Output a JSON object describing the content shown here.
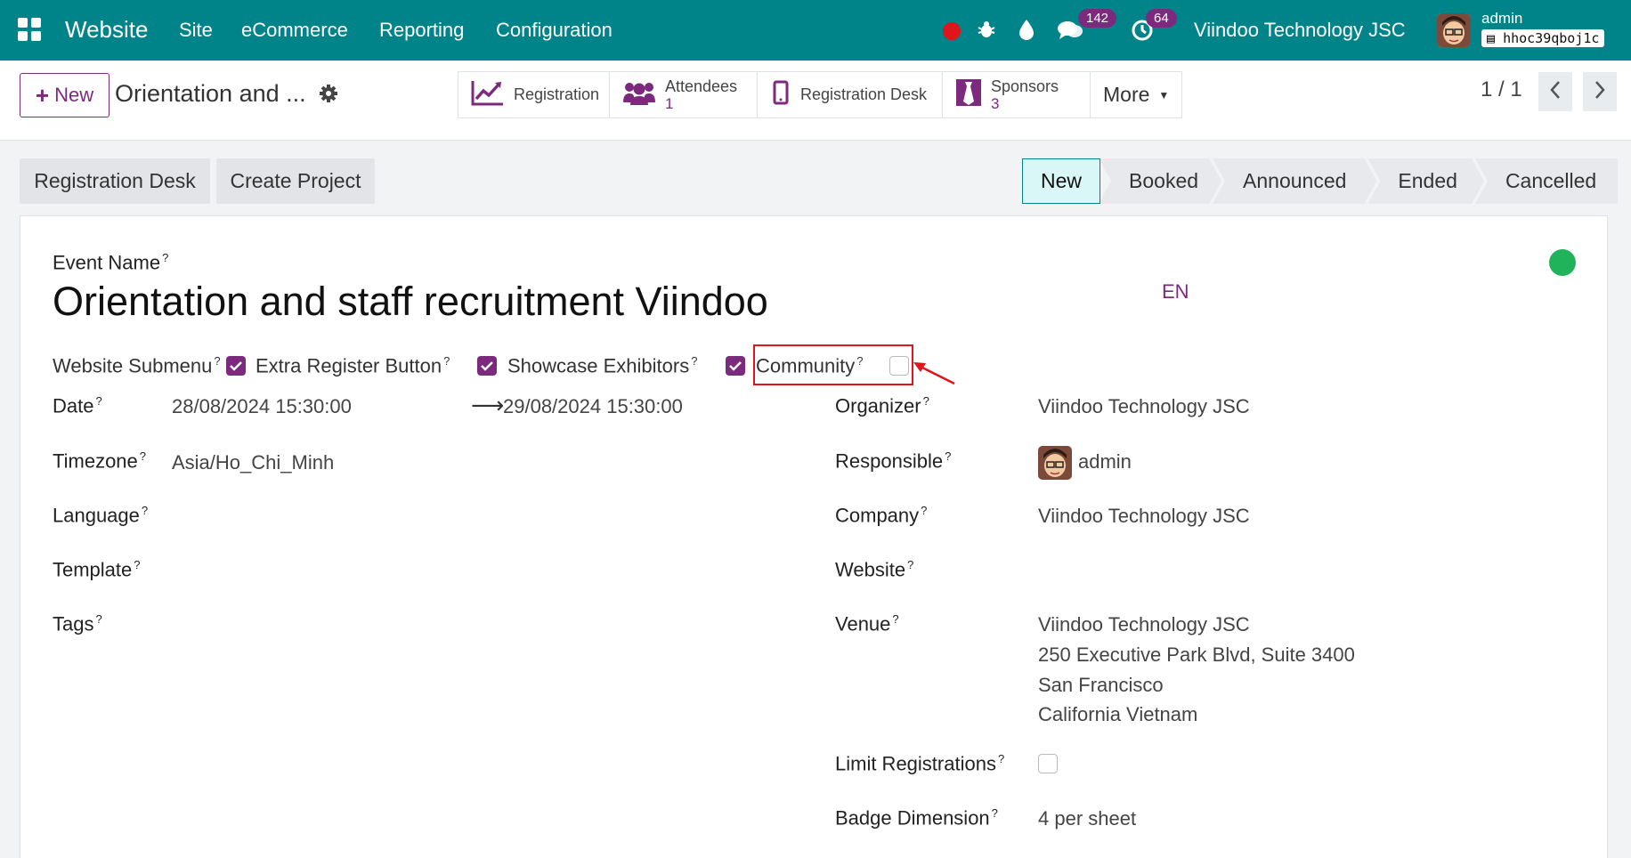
{
  "navbar": {
    "brand": "Website",
    "menus": [
      "Site",
      "eCommerce",
      "Reporting",
      "Configuration"
    ],
    "messages_count": "142",
    "activities_count": "64",
    "company": "Viindoo Technology JSC",
    "user": "admin",
    "database": "hhoc39qboj1c",
    "accent": "#00848a"
  },
  "control": {
    "new_label": "New",
    "record_title": "Orientation and ...",
    "smart_buttons": {
      "registration": "Registration",
      "attendees": "Attendees",
      "attendees_count": "1",
      "registration_desk": "Registration Desk",
      "sponsors": "Sponsors",
      "sponsors_count": "3",
      "more": "More"
    },
    "pager": "1 / 1"
  },
  "header": {
    "registration_desk": "Registration Desk",
    "create_project": "Create Project",
    "stages": [
      "New",
      "Booked",
      "Announced",
      "Ended",
      "Cancelled"
    ],
    "current_stage": "New"
  },
  "form": {
    "event_name_label": "Event Name",
    "event_name": "Orientation and staff recruitment Viindoo",
    "lang": "EN",
    "website_submenu_label": "Website Submenu",
    "extra_register_label": "Extra Register Button",
    "showcase_label": "Showcase Exhibitors",
    "community_label": "Community",
    "website_submenu": true,
    "extra_register": true,
    "showcase": true,
    "community": false,
    "date_label": "Date",
    "date_begin": "28/08/2024 15:30:00",
    "date_end": "29/08/2024 15:30:00",
    "timezone_label": "Timezone",
    "timezone": "Asia/Ho_Chi_Minh",
    "language_label": "Language",
    "template_label": "Template",
    "tags_label": "Tags",
    "organizer_label": "Organizer",
    "organizer": "Viindoo Technology JSC",
    "responsible_label": "Responsible",
    "responsible": "admin",
    "company_label": "Company",
    "company": "Viindoo Technology JSC",
    "website_label": "Website",
    "venue_label": "Venue",
    "venue_lines": [
      "Viindoo Technology JSC",
      "250 Executive Park Blvd, Suite 3400",
      "San Francisco",
      "California Vietnam"
    ],
    "limit_label": "Limit Registrations",
    "badge_label": "Badge Dimension",
    "badge_value": "4 per sheet",
    "help_mark": "?"
  }
}
